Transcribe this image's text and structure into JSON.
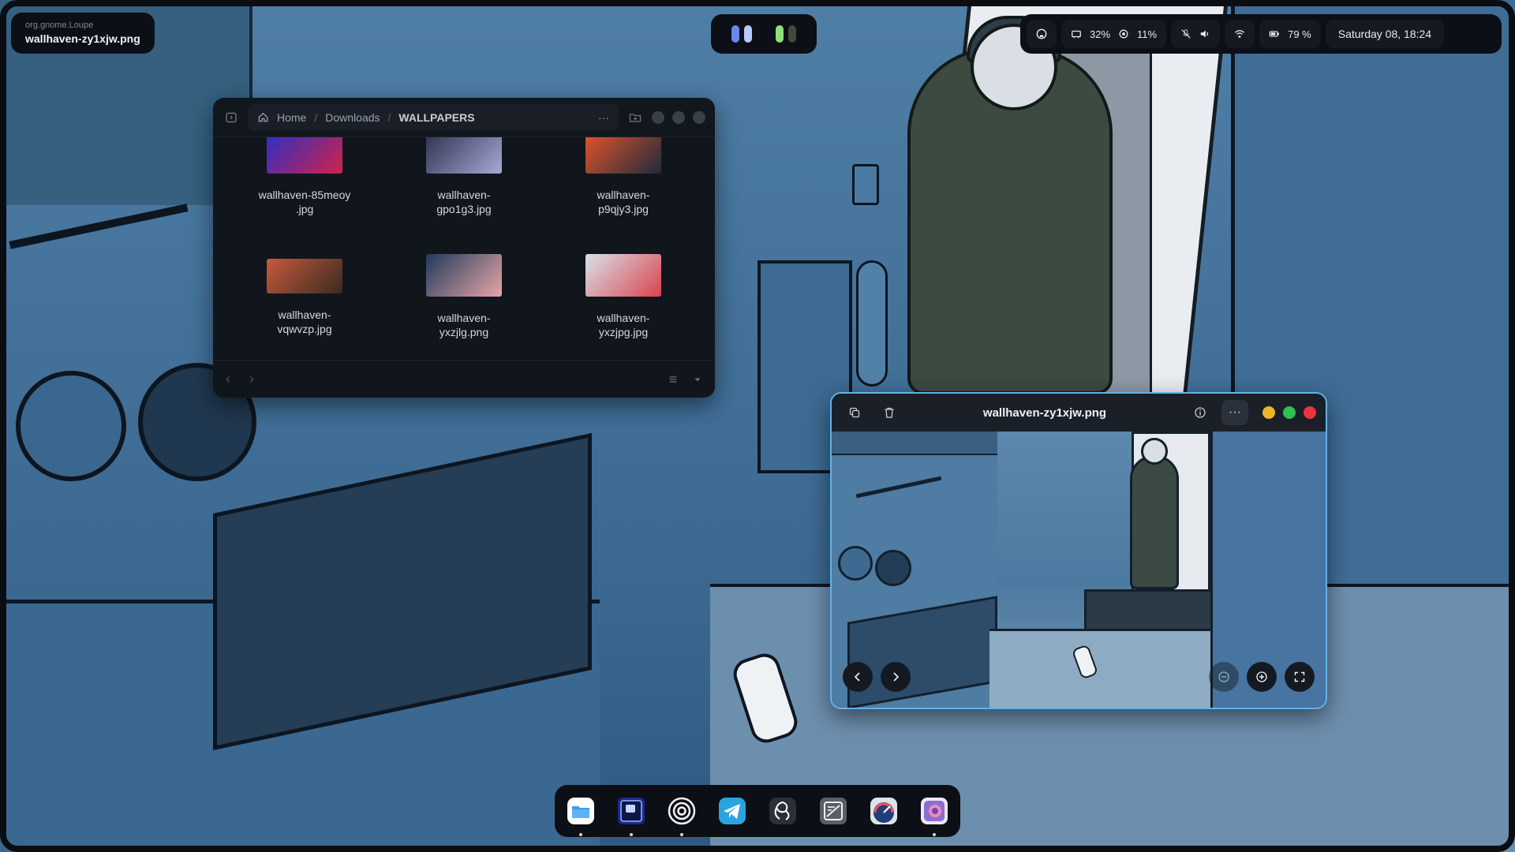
{
  "app_badge": {
    "app_id": "org.gnome.Loupe",
    "title": "wallhaven-zy1xjw.png"
  },
  "workspaces": {
    "colors": [
      "#6b86f0",
      "#b9c8ff",
      "#8ee07a",
      "#3f4a3a"
    ]
  },
  "status_bar": {
    "github_icon": "github-icon",
    "memory": "32%",
    "cpu": "11%",
    "mic_state": "muted",
    "volume_icon": "speaker-icon",
    "wifi_icon": "wifi-icon",
    "battery": "79 %",
    "datetime": "Saturday 08, 18:24"
  },
  "file_manager": {
    "breadcrumb": [
      "Home",
      "Downloads",
      "WALLPAPERS"
    ],
    "more_label": "···",
    "items": [
      {
        "name": "wallhaven-85meoy\n.jpg",
        "colors": [
          "#2a2fc7",
          "#d0234a"
        ]
      },
      {
        "name": "wallhaven-\ngpo1g3.jpg",
        "colors": [
          "#2d2f4a",
          "#a6a9d8"
        ]
      },
      {
        "name": "wallhaven-\np9qjy3.jpg",
        "colors": [
          "#e8552a",
          "#1e2a3c"
        ]
      },
      {
        "name": "wallhaven-\nvqwvzp.jpg",
        "colors": [
          "#c85a3a",
          "#3a2a22"
        ]
      },
      {
        "name": "wallhaven-\nyxzjlg.png",
        "colors": [
          "#1f3a5c",
          "#e8a5a8"
        ]
      },
      {
        "name": "wallhaven-\nyxzjpg.jpg",
        "colors": [
          "#d8e2ea",
          "#d8434e"
        ]
      }
    ],
    "footer": {
      "back": "‹",
      "forward": "›",
      "view_icon": "list-icon",
      "dropdown_icon": "chevron-down-icon"
    }
  },
  "image_viewer": {
    "title": "wallhaven-zy1xjw.png",
    "more_label": "···",
    "traffic": {
      "minimize": "#f0b428",
      "maximize": "#2ec14f",
      "close": "#ee3340"
    }
  },
  "dock": {
    "apps": [
      {
        "name": "files",
        "running": true
      },
      {
        "name": "text-editor",
        "running": true
      },
      {
        "name": "obs-like",
        "running": true
      },
      {
        "name": "telegram",
        "running": false
      },
      {
        "name": "obs-studio",
        "running": false
      },
      {
        "name": "mark-text",
        "running": false
      },
      {
        "name": "speedometer",
        "running": false
      },
      {
        "name": "image-viewer",
        "running": true
      }
    ]
  }
}
